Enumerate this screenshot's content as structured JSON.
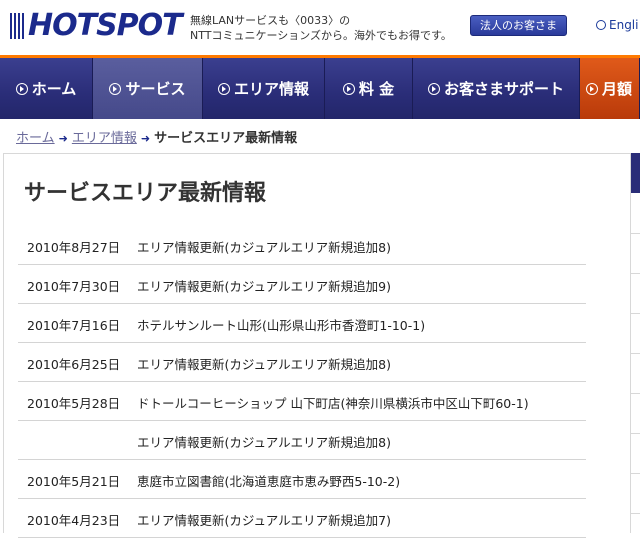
{
  "header": {
    "logo_text": "HOTSPOT",
    "tagline_line1": "無線LANサービスも〈0033〉の",
    "tagline_line2": "NTTコミュニケーションズから。海外でもお得です。",
    "business_button": "法人のお客さま",
    "lang_link": "Engli"
  },
  "nav": {
    "items": [
      {
        "label": "ホーム",
        "active": false
      },
      {
        "label": "サービス",
        "active": true
      },
      {
        "label": "エリア情報",
        "active": false
      },
      {
        "label": "料 金",
        "active": false
      },
      {
        "label": "お客さまサポート",
        "active": false
      },
      {
        "label": "月額",
        "active": false
      }
    ]
  },
  "breadcrumb": {
    "home": "ホーム",
    "area": "エリア情報",
    "current": "サービスエリア最新情報"
  },
  "page": {
    "title": "サービスエリア最新情報"
  },
  "news": [
    {
      "date": "2010年8月27日",
      "text": "エリア情報更新(カジュアルエリア新規追加8)"
    },
    {
      "date": "2010年7月30日",
      "text": "エリア情報更新(カジュアルエリア新規追加9)"
    },
    {
      "date": "2010年7月16日",
      "text": "ホテルサンルート山形(山形県山形市香澄町1-10-1)"
    },
    {
      "date": "2010年6月25日",
      "text": "エリア情報更新(カジュアルエリア新規追加8)"
    },
    {
      "date": "2010年5月28日",
      "text": "ドトールコーヒーショップ 山下町店(神奈川県横浜市中区山下町60-1)"
    },
    {
      "date": "",
      "text": "エリア情報更新(カジュアルエリア新規追加8)"
    },
    {
      "date": "2010年5月21日",
      "text": "恵庭市立図書館(北海道恵庭市恵み野西5-10-2)"
    },
    {
      "date": "2010年4月23日",
      "text": "エリア情報更新(カジュアルエリア新規追加7)"
    }
  ],
  "colors": {
    "brand": "#1b2a8c",
    "nav_accent": "#ff7a00",
    "nav_bg": "#2a2d78"
  }
}
